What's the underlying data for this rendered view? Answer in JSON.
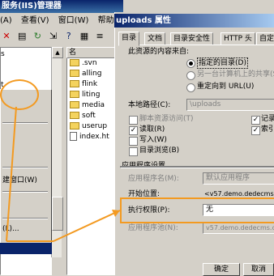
{
  "iis": {
    "title": "服务(IIS)管理器",
    "menu": [
      "(A)",
      "查看(V)",
      "窗口(W)",
      "帮助(H)"
    ],
    "tree_items": [
      "s",
      "t",
      "",
      ""
    ],
    "context_menu": [
      "建窗口(W)",
      "(L)..."
    ],
    "file_list_header": "名",
    "files": [
      {
        "name": ".svn",
        "type": "folder"
      },
      {
        "name": "alling",
        "type": "folder"
      },
      {
        "name": "flink",
        "type": "folder"
      },
      {
        "name": "liting",
        "type": "folder"
      },
      {
        "name": "media",
        "type": "folder"
      },
      {
        "name": "soft",
        "type": "folder"
      },
      {
        "name": "userup",
        "type": "folder"
      },
      {
        "name": "index.ht",
        "type": "file"
      }
    ]
  },
  "dialog": {
    "title": "uploads 属性",
    "tabs": [
      "目录",
      "文档",
      "目录安全性",
      "HTTP 头",
      "自定义"
    ],
    "source_header": "此资源的内容来自:",
    "source_options": [
      {
        "label": "指定的目录(D)",
        "selected": true,
        "enabled": true
      },
      {
        "label": "另一台计算机上的共享(S)",
        "selected": false,
        "enabled": false
      },
      {
        "label": "重定向到 URL(U)",
        "selected": false,
        "enabled": true
      }
    ],
    "local_path_label": "本地路径(C):",
    "local_path_value": "\\uploads",
    "perms_left": [
      {
        "label": "脚本资源访问(T)",
        "checked": false,
        "enabled": false
      },
      {
        "label": "读取(R)",
        "checked": true,
        "enabled": true
      },
      {
        "label": "写入(W)",
        "checked": false,
        "enabled": true
      },
      {
        "label": "目录浏览(B)",
        "checked": false,
        "enabled": true
      }
    ],
    "perms_right": [
      {
        "label": "记录",
        "checked": true
      },
      {
        "label": "索引",
        "checked": true
      }
    ],
    "app_settings_header": "应用程序设置",
    "app_name_label": "应用程序名(M):",
    "app_name_value": "默认应用程序",
    "start_point_label": "开始位置:",
    "start_point_value": "<v57.demo.dedecms.c",
    "exec_perm_label": "执行权限(P):",
    "exec_perm_value": "无",
    "app_pool_label": "应用程序池(N):",
    "app_pool_value": "v57.demo.dedecms.c",
    "ok_button": "确定",
    "cancel_button": "取消"
  },
  "colors": {
    "highlight": "#f39a21",
    "titlebar": "#0a246a",
    "window_face": "#d4d0c8"
  }
}
